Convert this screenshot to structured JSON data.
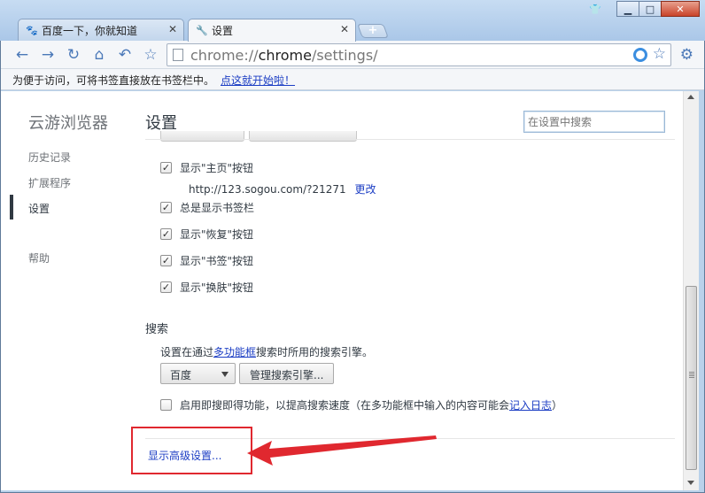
{
  "tabs": [
    {
      "title": "百度一下，你就知道",
      "icon": "baidu-paw-icon"
    },
    {
      "title": "设置",
      "icon": "wrench-icon"
    }
  ],
  "toolbar": {
    "url_prefix": "chrome://",
    "url_host": "chrome",
    "url_path": "/settings/"
  },
  "bookmark_bar": {
    "text": "为便于访问，可将书签直接放在书签栏中。",
    "link": "点这就开始啦！"
  },
  "sidebar": {
    "brand": "云游浏览器",
    "items": [
      {
        "label": "历史记录",
        "active": false
      },
      {
        "label": "扩展程序",
        "active": false
      },
      {
        "label": "设置",
        "active": true
      },
      {
        "label": "帮助",
        "active": false
      }
    ]
  },
  "settings": {
    "title": "设置",
    "search_placeholder": "在设置中搜索",
    "appearance": {
      "show_home": {
        "label": "显示\"主页\"按钮",
        "checked": true
      },
      "home_url": "http://123.sogou.com/?21271",
      "home_change": "更改",
      "always_bookmarks": {
        "label": "总是显示书签栏",
        "checked": true
      },
      "show_restore": {
        "label": "显示\"恢复\"按钮",
        "checked": true
      },
      "show_bookmark": {
        "label": "显示\"书签\"按钮",
        "checked": true
      },
      "show_skin": {
        "label": "显示\"换肤\"按钮",
        "checked": true
      }
    },
    "search": {
      "title": "搜索",
      "desc_before": "设置在通过",
      "desc_link": "多功能框",
      "desc_after": "搜索时所用的搜索引擎。",
      "engine": "百度",
      "manage_button": "管理搜索引擎...",
      "instant_text": "启用即搜即得功能，以提高搜索速度（在多功能框中输入的内容可能会",
      "instant_link": "记入日志",
      "instant_close": "）",
      "instant_checked": false
    },
    "advanced_link": "显示高级设置..."
  },
  "colors": {
    "link": "#1c3ec4",
    "annotation": "#e0282f"
  }
}
